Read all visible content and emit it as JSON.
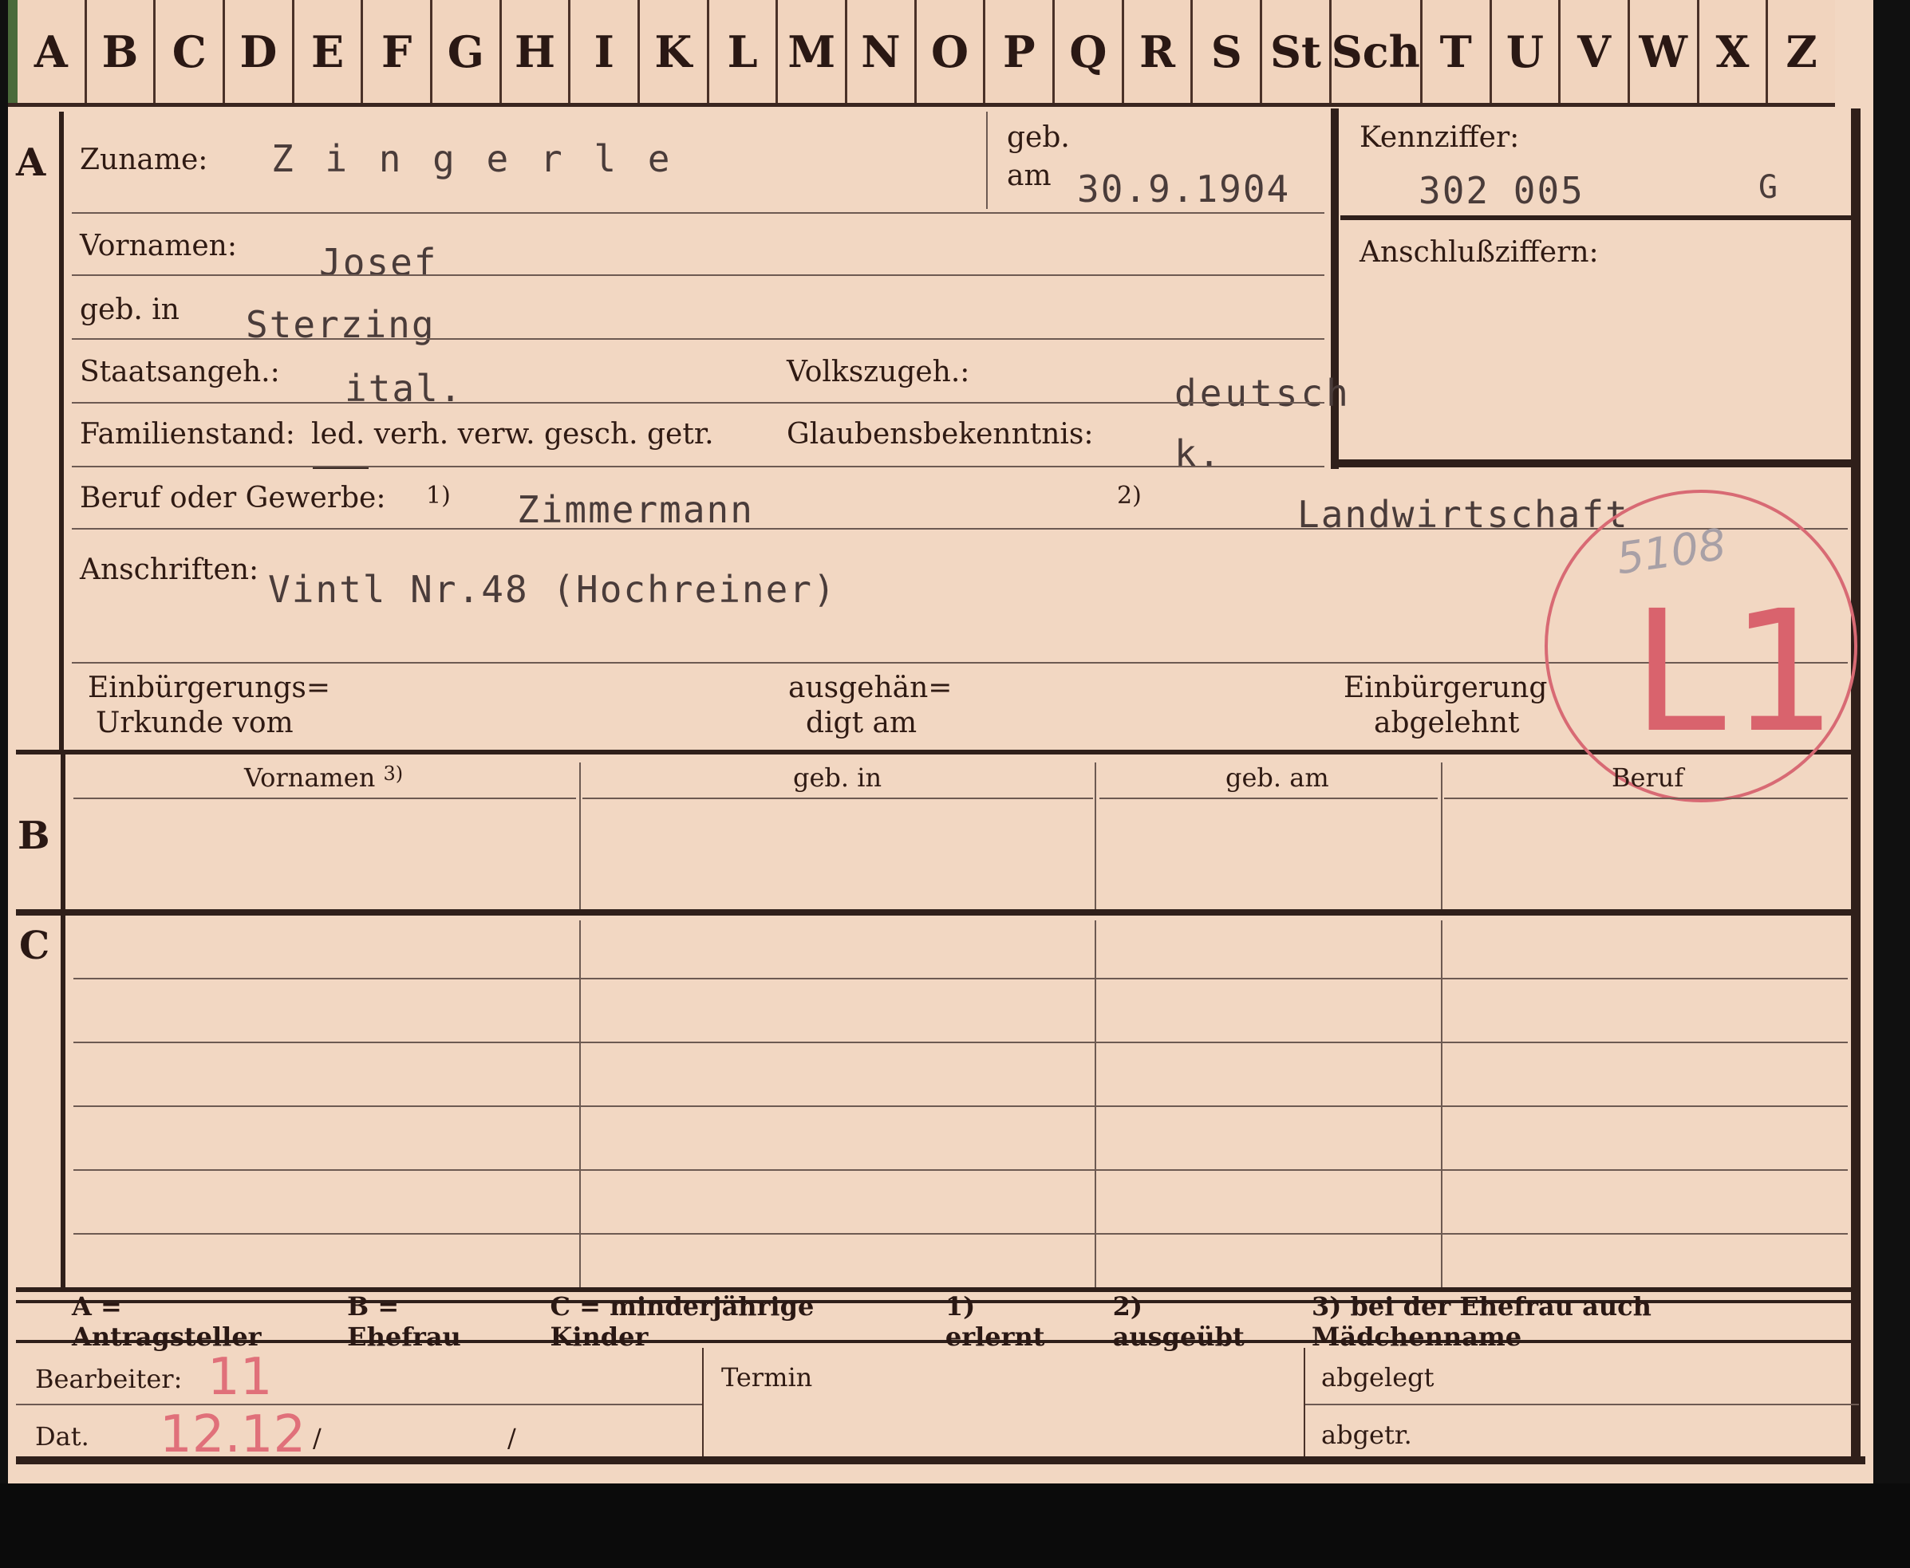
{
  "tabs": [
    "A",
    "B",
    "C",
    "D",
    "E",
    "F",
    "G",
    "H",
    "I",
    "K",
    "L",
    "M",
    "N",
    "O",
    "P",
    "Q",
    "R",
    "S",
    "St",
    "Sch",
    "T",
    "U",
    "V",
    "W",
    "X",
    "Z"
  ],
  "section_a": {
    "letter": "A",
    "zuname_label": "Zuname:",
    "zuname_value": "Z i n g e r l e",
    "geb_label": "geb.",
    "am_label": "am",
    "geb_am_value": "30.9.1904",
    "vornamen_label": "Vornamen:",
    "vornamen_value": "Josef",
    "geb_in_label": "geb. in",
    "geb_in_value": "Sterzing",
    "staatsangeh_label": "Staatsangeh.:",
    "staatsangeh_value": "ital.",
    "volkszugeh_label": "Volkszugeh.:",
    "volkszugeh_value": "deutsch",
    "familienstand_label": "Familienstand:",
    "familienstand_options": "led. verh. verw. gesch. getr.",
    "glaubens_label": "Glaubensbekenntnis:",
    "glaubens_value": "k.",
    "beruf_label": "Beruf oder Gewerbe:",
    "beruf_note1": "1)",
    "beruf_value1": "Zimmermann",
    "beruf_note2": "2)",
    "beruf_value2": "Landwirtschaft",
    "anschriften_label": "Anschriften:",
    "anschriften_value": "Vintl Nr.48 (Hochreiner)",
    "einbuergerung_urkunde_l1": "Einbürgerungs=",
    "einbuergerung_urkunde_l2": "Urkunde vom",
    "ausgehaendigt_l1": "ausgehän=",
    "ausgehaendigt_l2": "digt am",
    "abgelehnt_l1": "Einbürgerung",
    "abgelehnt_l2": "abgelehnt"
  },
  "kennziffer": {
    "label": "Kennziffer:",
    "value": "302 005",
    "suffix": "G",
    "anschluss_label": "Anschlußziffern:"
  },
  "stamp": {
    "code": "L1",
    "number": "5108"
  },
  "section_b": {
    "letter": "B",
    "col_vornamen": "Vornamen",
    "col_vornamen_note": "3)",
    "col_geb_in": "geb. in",
    "col_geb_am": "geb. am",
    "col_beruf": "Beruf"
  },
  "section_c": {
    "letter": "C"
  },
  "legend": {
    "a": "A = Antragsteller",
    "b": "B = Ehefrau",
    "c": "C = minderjährige Kinder",
    "n1": "1) erlernt",
    "n2": "2) ausgeübt",
    "n3": "3) bei der Ehefrau auch Mädchenname"
  },
  "footer": {
    "bearbeiter_label": "Bearbeiter:",
    "bearbeiter_value": "11",
    "dat_label": "Dat.",
    "dat_value": "12.12",
    "dat_slash1": "/",
    "dat_slash2": "/",
    "termin_label": "Termin",
    "abgelegt_label": "abgelegt",
    "abgetr_label": "abgetr."
  }
}
